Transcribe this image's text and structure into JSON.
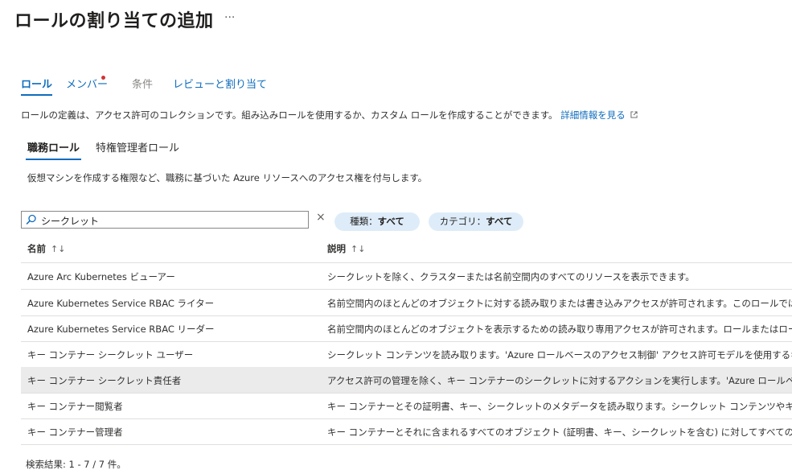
{
  "page": {
    "title": "ロールの割り当ての追加",
    "more": "···"
  },
  "tabs": [
    {
      "label": "ロール"
    },
    {
      "label": "メンバー"
    },
    {
      "label": "条件"
    },
    {
      "label": "レビューと割り当て"
    }
  ],
  "description": {
    "text": "ロールの定義は、アクセス許可のコレクションです。組み込みロールを使用するか、カスタム ロールを作成することができます。",
    "link": "詳細情報を見る"
  },
  "subtabs": [
    {
      "label": "職務ロール"
    },
    {
      "label": "特権管理者ロール"
    }
  ],
  "subdescription": "仮想マシンを作成する権限など、職務に基づいた Azure リソースへのアクセス権を付与します。",
  "search": {
    "value": "シークレット",
    "clear": "×"
  },
  "filters": [
    {
      "label": "種類：",
      "value": "すべて"
    },
    {
      "label": "カテゴリ：",
      "value": "すべて"
    }
  ],
  "table": {
    "columns": {
      "name": "名前",
      "description": "説明",
      "sort": "↑↓"
    },
    "rows": [
      {
        "name": "Azure Arc Kubernetes ビューアー",
        "description": "シークレットを除く、クラスターまたは名前空間内のすべてのリソースを表示できます。"
      },
      {
        "name": "Azure Kubernetes Service RBAC ライター",
        "description": "名前空間内のほとんどのオブジェクトに対する読み取りまたは書き込みアクセスが許可されます。このロールでは、ロール"
      },
      {
        "name": "Azure Kubernetes Service RBAC リーダー",
        "description": "名前空間内のほとんどのオブジェクトを表示するための読み取り専用アクセスが許可されます。ロールまたはロール バインド"
      },
      {
        "name": "キー コンテナー シークレット ユーザー",
        "description": "シークレット コンテンツを読み取ります。'Azure ロールベースのアクセス制御' アクセス許可モデルを使用するキー コンテナ"
      },
      {
        "name": "キー コンテナー シークレット責任者",
        "description": "アクセス許可の管理を除く、キー コンテナーのシークレットに対するアクションを実行します。'Azure ロールベースのアクセス"
      },
      {
        "name": "キー コンテナー閲覧者",
        "description": "キー コンテナーとその証明書、キー、シークレットのメタデータを読み取ります。シークレット コンテンツやキー マテリアルな"
      },
      {
        "name": "キー コンテナー管理者",
        "description": "キー コンテナーとそれに含まれるすべてのオブジェクト (証明書、キー、シークレットを含む) に対してすべてのデータ プレーン"
      }
    ]
  },
  "footer": "検索結果: 1 - 7 / 7 件。",
  "colors": {
    "accent": "#0f6cbd",
    "required_dot": "#d13438",
    "pill_bg": "#deecf9",
    "selected_row": "#ebebeb"
  }
}
